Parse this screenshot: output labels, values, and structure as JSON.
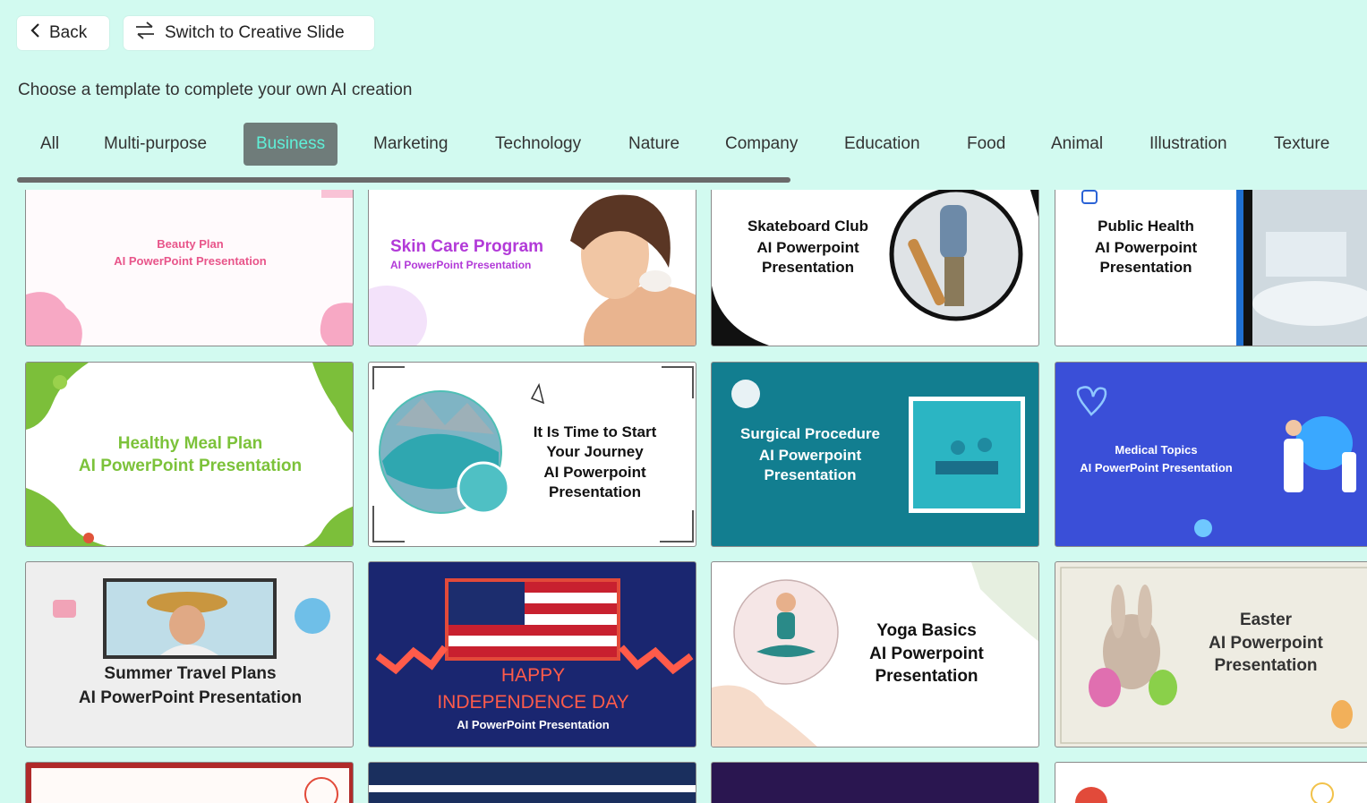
{
  "header": {
    "back_label": "Back",
    "switch_label": "Switch to Creative Slide",
    "subtitle": "Choose a template to complete your own AI creation"
  },
  "tabs": [
    {
      "label": "All"
    },
    {
      "label": "Multi-purpose"
    },
    {
      "label": "Business",
      "active": true
    },
    {
      "label": "Marketing"
    },
    {
      "label": "Technology"
    },
    {
      "label": "Nature"
    },
    {
      "label": "Company"
    },
    {
      "label": "Education"
    },
    {
      "label": "Food"
    },
    {
      "label": "Animal"
    },
    {
      "label": "Illustration"
    },
    {
      "label": "Texture"
    }
  ],
  "templates": [
    {
      "title": "Beauty Plan",
      "subtitle": "AI PowerPoint Presentation",
      "title_color": "#e8558a"
    },
    {
      "title": "Skin Care Program",
      "subtitle": "AI PowerPoint Presentation",
      "title_color": "#b23ad8"
    },
    {
      "title": "Skateboard Club",
      "subtitle": "AI Powerpoint",
      "subtitle2": "Presentation"
    },
    {
      "title": "Public Health",
      "subtitle": "AI Powerpoint",
      "subtitle2": "Presentation"
    },
    {
      "title": "Healthy Meal Plan",
      "subtitle": "AI PowerPoint Presentation",
      "title_color": "#7cc23a"
    },
    {
      "title": "It Is Time to Start",
      "line2": "Your Journey",
      "subtitle": "AI Powerpoint",
      "subtitle2": "Presentation"
    },
    {
      "title": "Surgical Procedure",
      "subtitle": "AI Powerpoint",
      "subtitle2": "Presentation",
      "bg": "#127e90"
    },
    {
      "title": "Medical Topics",
      "subtitle": "AI PowerPoint Presentation",
      "bg": "#3a4fd8"
    },
    {
      "title": "Summer Travel Plans",
      "subtitle": "AI PowerPoint Presentation"
    },
    {
      "title": "HAPPY",
      "line2": "INDEPENDENCE DAY",
      "subtitle": "AI PowerPoint Presentation",
      "bg": "#1a2670",
      "title_color": "#ff5b4a"
    },
    {
      "title": "Yoga Basics",
      "subtitle": "AI Powerpoint",
      "subtitle2": "Presentation"
    },
    {
      "title": "Easter",
      "subtitle": "AI Powerpoint",
      "subtitle2": "Presentation"
    }
  ]
}
